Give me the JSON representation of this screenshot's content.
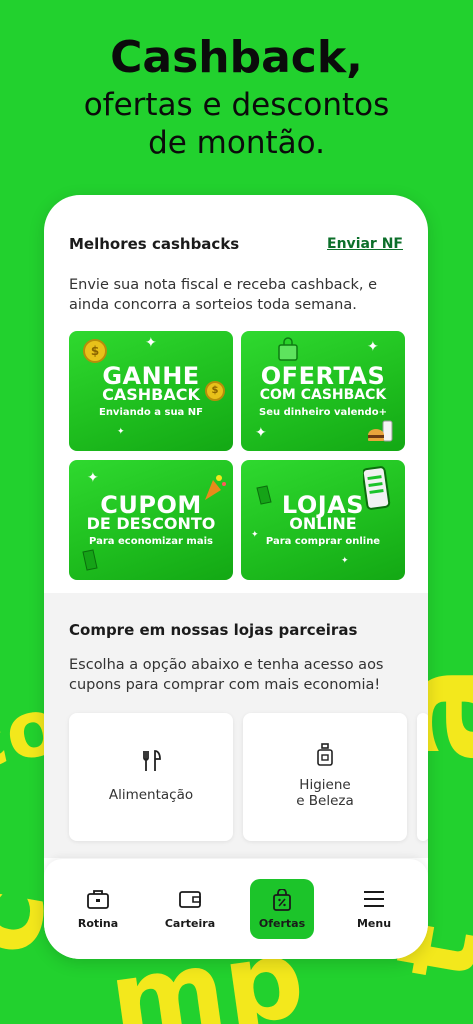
{
  "headline": {
    "line1": "Cashback,",
    "line2": "ofertas e descontos",
    "line3": "de montão."
  },
  "cashbacks": {
    "title": "Melhores cashbacks",
    "link": "Enviar NF",
    "description": "Envie sua nota fiscal e receba cashback, e ainda concorra a sorteios toda semana.",
    "cards": [
      {
        "title": "GANHE",
        "title2": "CASHBACK",
        "subtitle": "Enviando a sua NF"
      },
      {
        "title": "OFERTAS",
        "title2": "COM CASHBACK",
        "subtitle": "Seu dinheiro valendo+"
      },
      {
        "title": "CUPOM",
        "title2": "DE DESCONTO",
        "subtitle": "Para economizar mais"
      },
      {
        "title": "LOJAS",
        "title2": "ONLINE",
        "subtitle": "Para comprar online"
      }
    ]
  },
  "partners": {
    "title": "Compre em nossas lojas parceiras",
    "description": "Escolha a opção abaixo e tenha acesso aos cupons para comprar com mais economia!",
    "items": [
      {
        "label": "Alimentação",
        "icon": "utensils-icon"
      },
      {
        "label": "Higiene",
        "label2": "e Beleza",
        "icon": "perfume-bottle-icon"
      }
    ]
  },
  "nav": {
    "items": [
      {
        "label": "Rotina",
        "icon": "briefcase-icon"
      },
      {
        "label": "Carteira",
        "icon": "wallet-icon"
      },
      {
        "label": "Ofertas",
        "icon": "shopping-bag-percent-icon",
        "active": true
      },
      {
        "label": "Menu",
        "icon": "hamburger-menu-icon"
      }
    ]
  },
  "colors": {
    "background": "#22d12e",
    "accent_green": "#1cc42a",
    "link_green": "#0c6f2a",
    "decor_yellow": "#f3e81c"
  }
}
